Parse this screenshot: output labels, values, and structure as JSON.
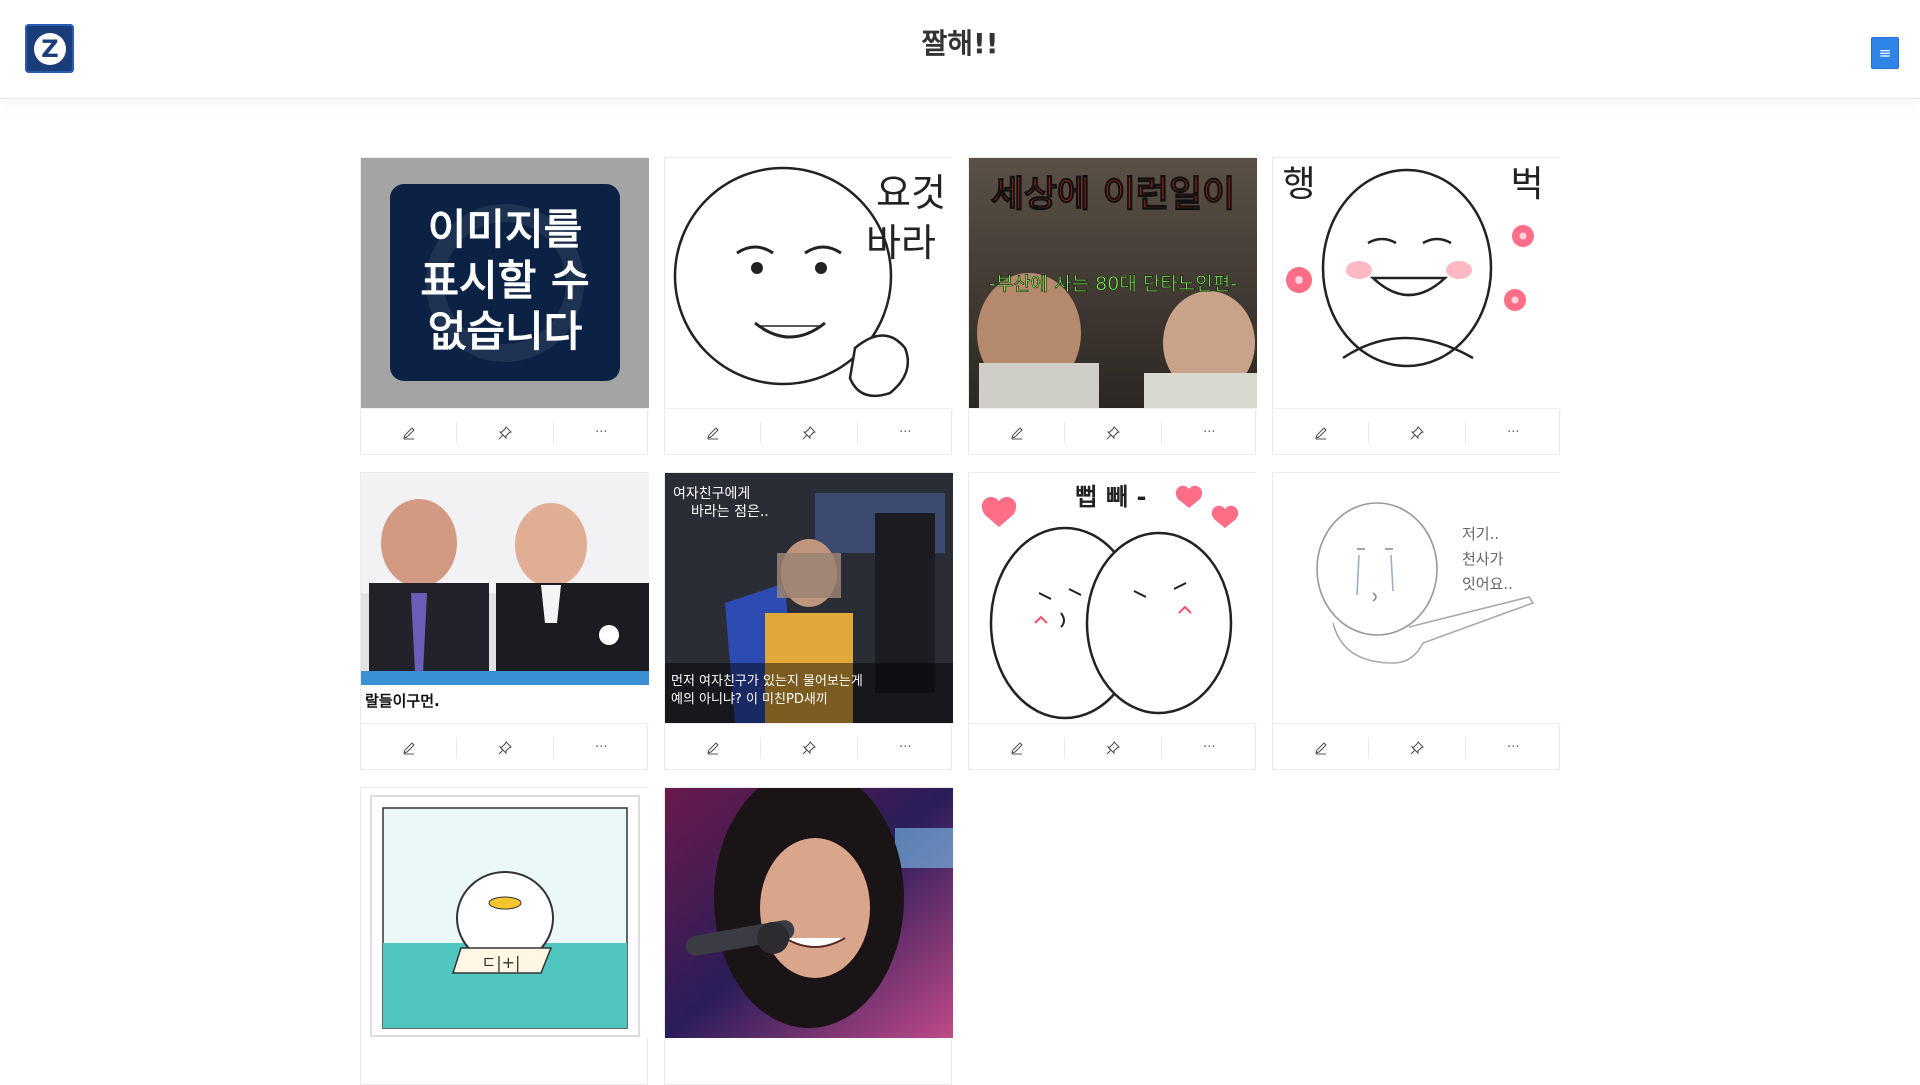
{
  "header": {
    "title": "짤해!!",
    "logo_letter": "Z",
    "menu_icon": "hamburger-icon",
    "brand_color": "#1b3d7a",
    "menu_color": "#2f86e8"
  },
  "cards": [
    {
      "image_text_1": "이미지를",
      "image_text_2": "표시할 수",
      "image_text_3": "없습니다"
    },
    {
      "image_text_1": "요것",
      "image_text_2": "바라"
    },
    {
      "image_text_1": "세상에 이런일이",
      "image_text_2": "-부산에 사는 80대 단타노인편-"
    },
    {
      "image_text_1": "행",
      "image_text_2": "벅"
    },
    {
      "image_text_1": "랄들이구먼."
    },
    {
      "image_text_1": "여자친구에게",
      "image_text_2": "바라는 점은..",
      "image_text_3": "먼저 여자친구가 있는지 물어보는게",
      "image_text_4": "예의 아니냐? 이 미친PD새끼"
    },
    {
      "image_text_1": "뻡 빼 -"
    },
    {
      "image_text_1": "저기..",
      "image_text_2": "천사가",
      "image_text_3": "잇어요.."
    },
    {
      "image_text_1": "ㄷ|+|"
    },
    {}
  ],
  "actions": {
    "edit_icon": "pencil-icon",
    "pin_icon": "pin-icon",
    "more_label": "···"
  }
}
